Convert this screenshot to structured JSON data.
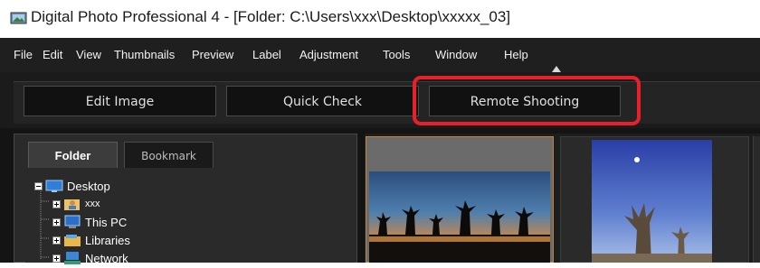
{
  "window": {
    "title": "Digital Photo Professional 4 - [Folder: C:\\Users\\xxx\\Desktop\\xxxxx_03]"
  },
  "menu": [
    {
      "label": "File"
    },
    {
      "label": "Edit"
    },
    {
      "label": "View"
    },
    {
      "label": "Thumbnails"
    },
    {
      "label": "Preview"
    },
    {
      "label": "Label"
    },
    {
      "label": "Adjustment"
    },
    {
      "label": "Tools"
    },
    {
      "label": "Window"
    },
    {
      "label": "Help"
    }
  ],
  "toolbar": {
    "buttons": [
      {
        "label": "Edit Image"
      },
      {
        "label": "Quick Check"
      },
      {
        "label": "Remote Shooting",
        "highlighted": true
      }
    ]
  },
  "left_panel": {
    "tabs": [
      {
        "label": "Folder",
        "active": true
      },
      {
        "label": "Bookmark",
        "active": false
      }
    ],
    "tree": [
      {
        "label": "Desktop",
        "icon": "desktop-icon",
        "expanded": true
      },
      {
        "label": "xxx",
        "icon": "user-folder-icon"
      },
      {
        "label": "This PC",
        "icon": "computer-icon"
      },
      {
        "label": "Libraries",
        "icon": "libraries-icon"
      },
      {
        "label": "Network",
        "icon": "network-icon"
      }
    ]
  },
  "colors": {
    "highlight": "#e8202a",
    "selection_border": "#c0863b"
  }
}
